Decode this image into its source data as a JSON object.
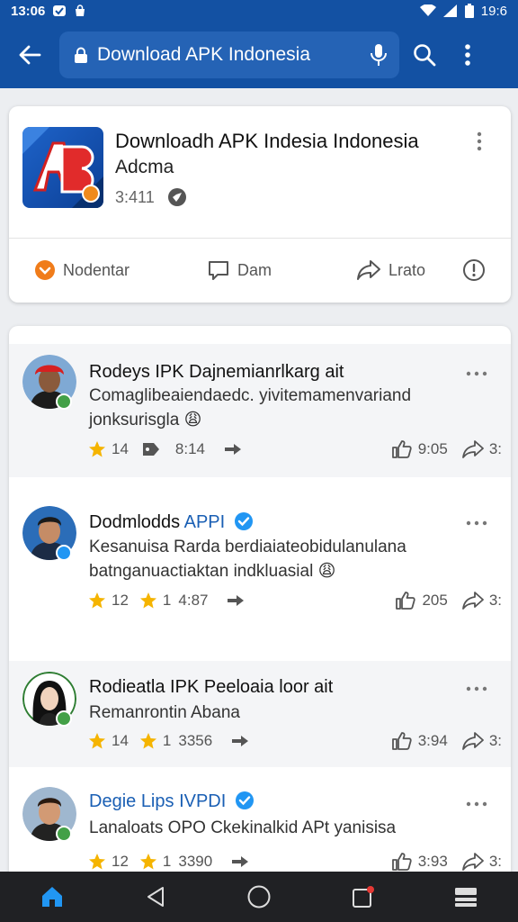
{
  "status_bar": {
    "time": "13:06",
    "right_text": "19:6"
  },
  "browser": {
    "url": "Download APK Indonesia",
    "icons": [
      "back-arrow-icon",
      "lock-icon",
      "microphone-icon",
      "search-icon",
      "more-vert-icon"
    ]
  },
  "app_card": {
    "title": "Downloadh APK Indesia Indonesia",
    "subtitle": "Adcma",
    "meta": "3:411",
    "actions": [
      {
        "label": "Nodentar",
        "icon": "download-icon"
      },
      {
        "label": "Dam",
        "icon": "comment-icon"
      },
      {
        "label": "Lrato",
        "icon": "share-icon"
      },
      {
        "label": "",
        "icon": "info-icon"
      }
    ]
  },
  "posts": [
    {
      "name": "Rodeys IPK Dajnemianrlkarg ait",
      "tag": "",
      "line1": "Comaglibeaiendaedc. yivitemamenvariand",
      "line2": "jonksurisgla 😩",
      "s1": "14",
      "s2": "",
      "s3": "8:14",
      "likes": "9:05",
      "shares": "3:"
    },
    {
      "name": "Dodmlodds ",
      "tag": "APPI",
      "line1": "Kesanuisa Rarda berdiaiateobidulanulana",
      "line2": "batnganuactiaktan indkluasial 😩",
      "s1": "12",
      "s2": "1",
      "s3": "4:87",
      "likes": "205",
      "shares": "3:"
    },
    {
      "name": "Rodieatla IPK Peeloaia loor ait",
      "tag": "",
      "line1": "Remanrontin Abana",
      "line2": "",
      "s1": "14",
      "s2": "1",
      "s3": "3356",
      "likes": "3:94",
      "shares": "3:"
    },
    {
      "name": "Degie Lips ",
      "tag": "IVPDI",
      "line1": "Lanaloats OPO Ckekinalkid APt yanisisa",
      "line2": "",
      "s1": "12",
      "s2": "1",
      "s3": "3390",
      "likes": "3:93",
      "shares": "3:"
    }
  ],
  "nav_icons": [
    "home-icon",
    "back-triangle-icon",
    "home-circle-icon",
    "recents-square-icon",
    "menu-icon"
  ],
  "colors": {
    "brand": "#1351a3",
    "accent": "#1a5fb4",
    "star": "#f5b400",
    "verified": "#2196f3",
    "online": "#43a047"
  }
}
